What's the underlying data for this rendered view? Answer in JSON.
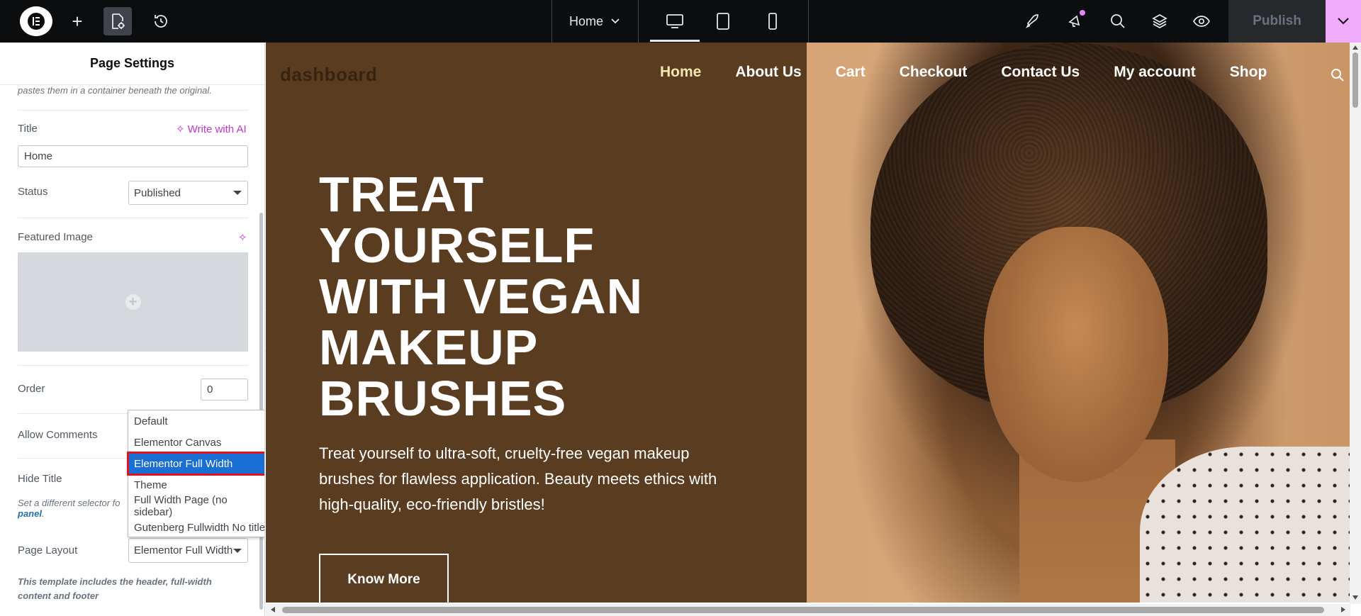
{
  "topbar": {
    "icons": [
      "elementor-logo-icon",
      "plus-icon",
      "page-settings-icon",
      "history-icon",
      "rocket-icon",
      "notification-icon",
      "search-icon",
      "layers-icon",
      "preview-icon"
    ],
    "page_selector": "Home",
    "devices": [
      "desktop-icon",
      "tablet-icon",
      "mobile-icon"
    ],
    "publish_label": "Publish"
  },
  "panel": {
    "title": "Page Settings",
    "top_note": "pastes them in a container beneath the original.",
    "title_label": "Title",
    "write_ai": "Write with AI",
    "title_value": "Home",
    "status_label": "Status",
    "status_value": "Published",
    "featured_label": "Featured Image",
    "order_label": "Order",
    "order_value": "0",
    "comments_label": "Allow Comments",
    "hide_title_label": "Hide Title",
    "hide_hint_prefix": "Set a different selector fo",
    "hide_hint_link": "panel",
    "layout_label": "Page Layout",
    "layout_value": "Elementor Full Width",
    "layout_hint": "This template includes the header, full-width content and footer",
    "dropdown_options": [
      "Default",
      "Elementor Canvas",
      "Elementor Full Width",
      "Theme",
      "Full Width Page (no sidebar)",
      "Gutenberg Fullwidth No title"
    ],
    "dropdown_selected": "Elementor Full Width"
  },
  "site": {
    "logo": "dashboard",
    "nav": [
      "Home",
      "About Us",
      "Cart",
      "Checkout",
      "Contact Us",
      "My account",
      "Shop"
    ],
    "nav_active": "Home",
    "headline": "TREAT YOURSELF WITH VEGAN MAKEUP BRUSHES",
    "subtext": "Treat yourself to ultra-soft, cruelty-free vegan makeup brushes for flawless application. Beauty meets ethics with high-quality, eco-friendly bristles!",
    "cta": "Know More"
  },
  "colors": {
    "hero_bg": "#5a3c20",
    "nav_active": "#f3e7b2",
    "accent_ai": "#c036d3",
    "publish_toggle": "#f0abfc"
  }
}
